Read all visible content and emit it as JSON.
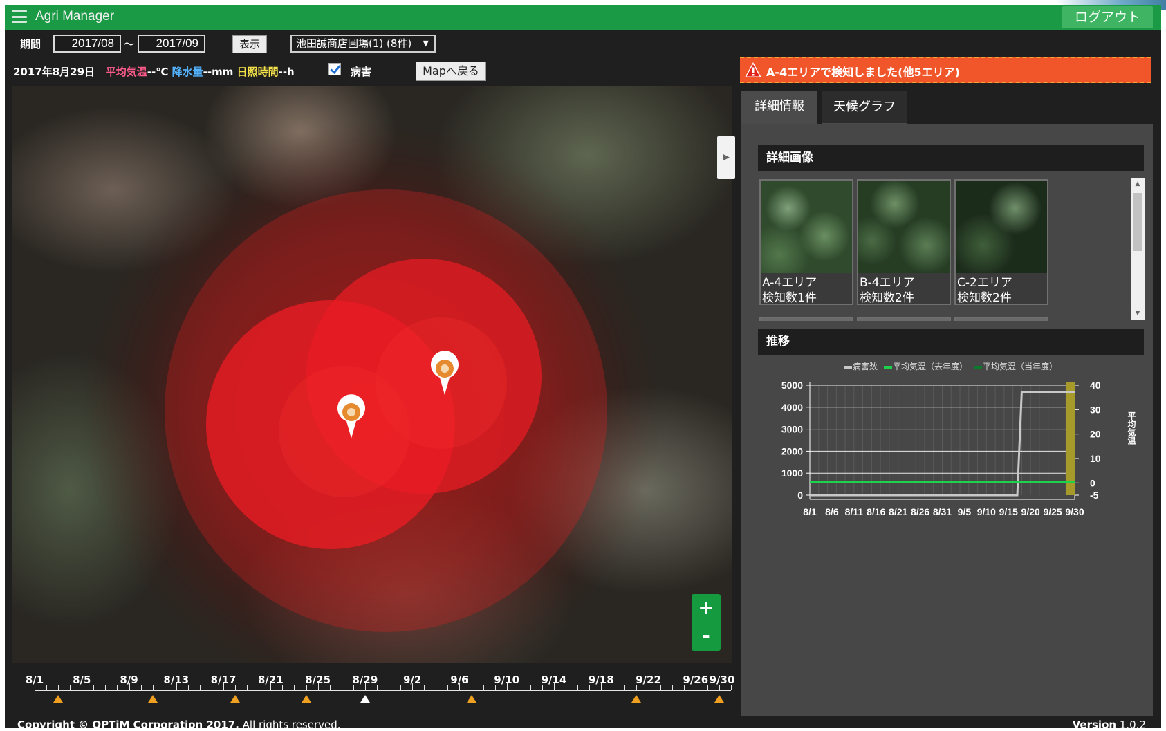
{
  "header": {
    "app_title": "Agri Manager",
    "logout_label": "ログアウト"
  },
  "toolbar": {
    "period_label": "期間",
    "date_from": "2017/08",
    "range_sep": "〜",
    "date_to": "2017/09",
    "show_label": "表示",
    "farm_select": "池田誠商店圃場(1) (8件)",
    "map_back_label": "Mapへ戻る"
  },
  "weather": {
    "date": "2017年8月29日",
    "temp_label": "平均気温",
    "temp_value": "--℃",
    "rain_label": "降水量",
    "rain_value": "--mm",
    "sun_label": "日照時間",
    "sun_value": "--h",
    "pest_label": "病害",
    "pest_checked": true
  },
  "map": {
    "expand_icon": "▶",
    "zoom_in": "+",
    "zoom_out": "-",
    "pins": [
      {
        "icon": "pest-pin-icon"
      },
      {
        "icon": "pest-pin-icon"
      }
    ]
  },
  "timeline": {
    "labels": [
      "8/1",
      "8/5",
      "8/9",
      "8/13",
      "8/17",
      "8/21",
      "8/25",
      "8/29",
      "9/2",
      "9/6",
      "9/10",
      "9/14",
      "9/18",
      "9/22",
      "9/26",
      "9/30"
    ],
    "markers": [
      "8/3",
      "8/11",
      "8/18",
      "8/24",
      "9/7",
      "9/21",
      "9/28"
    ],
    "current": "8/29"
  },
  "alert": {
    "text": "A-4エリアで検知しました(他5エリア)"
  },
  "tabs": [
    {
      "label": "詳細情報",
      "active": true
    },
    {
      "label": "天候グラフ",
      "active": false
    }
  ],
  "detail_images": {
    "title": "詳細画像",
    "items": [
      {
        "area": "A-4エリア",
        "count": "検知数1件"
      },
      {
        "area": "B-4エリア",
        "count": "検知数2件"
      },
      {
        "area": "C-2エリア",
        "count": "検知数2件"
      }
    ]
  },
  "trend": {
    "title": "推移",
    "chart_data": {
      "type": "line",
      "x_labels": [
        "8/1",
        "8/6",
        "8/11",
        "8/16",
        "8/21",
        "8/26",
        "8/31",
        "9/5",
        "9/10",
        "9/15",
        "9/20",
        "9/25",
        "9/30"
      ],
      "y_left_ticks": [
        0,
        1000,
        2000,
        3000,
        4000,
        5000
      ],
      "y_left_range": [
        0,
        5000
      ],
      "y_right_ticks": [
        -5,
        0,
        10,
        20,
        30,
        40
      ],
      "y_right_range": [
        -5,
        40
      ],
      "y_right_label": "平均気温",
      "grid": true,
      "legend": [
        "病害数",
        "平均気温（去年度）",
        "平均気温（当年度）"
      ],
      "legend_placement": "top",
      "series": [
        {
          "name": "病害数",
          "color": "#c8c8c8",
          "x": [
            "8/1",
            "9/17",
            "9/18",
            "9/30"
          ],
          "values": [
            0,
            0,
            4700,
            4700
          ]
        },
        {
          "name": "平均気温（去年度）",
          "color": "#1bd44b",
          "x": [
            "8/1",
            "9/30"
          ],
          "values": [
            600,
            600
          ]
        }
      ],
      "highlight_range": [
        "9/28",
        "9/30"
      ],
      "highlight_color": "#a69a2a"
    }
  }
}
